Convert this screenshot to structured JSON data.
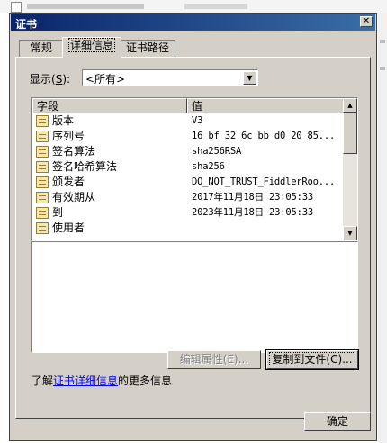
{
  "window": {
    "title": "证书",
    "close_glyph": "✕"
  },
  "tabs": [
    {
      "label": "常规",
      "active": false
    },
    {
      "label": "详细信息",
      "active": true
    },
    {
      "label": "证书路径",
      "active": false
    }
  ],
  "show": {
    "label": "显示",
    "accel_prefix": "(",
    "accel_key": "S",
    "accel_suffix": "):",
    "selected": "<所有>"
  },
  "table": {
    "headers": [
      "字段",
      "值"
    ],
    "rows": [
      {
        "field": "版本",
        "value": "V3"
      },
      {
        "field": "序列号",
        "value": "16 bf 32 6c bb d0 20 85..."
      },
      {
        "field": "签名算法",
        "value": "sha256RSA"
      },
      {
        "field": "签名哈希算法",
        "value": "sha256"
      },
      {
        "field": "颁发者",
        "value": "DO_NOT_TRUST_FiddlerRoo..."
      },
      {
        "field": "有效期从",
        "value": "2017年11月18日 23:05:33"
      },
      {
        "field": "到",
        "value": "2023年11月18日 23:05:33"
      },
      {
        "field": "使用者",
        "value": ""
      }
    ]
  },
  "buttons": {
    "edit_properties": "编辑属性(E)...",
    "copy_to_file": "复制到文件(C)...",
    "ok": "确定"
  },
  "learn_more": {
    "prefix": "了解",
    "link": "证书详细信息",
    "suffix": "的更多信息"
  },
  "colors": {
    "titlebar_start": "#0a246a",
    "titlebar_end": "#3a6ea5",
    "face": "#d4d0c8",
    "link": "#0000ff"
  }
}
